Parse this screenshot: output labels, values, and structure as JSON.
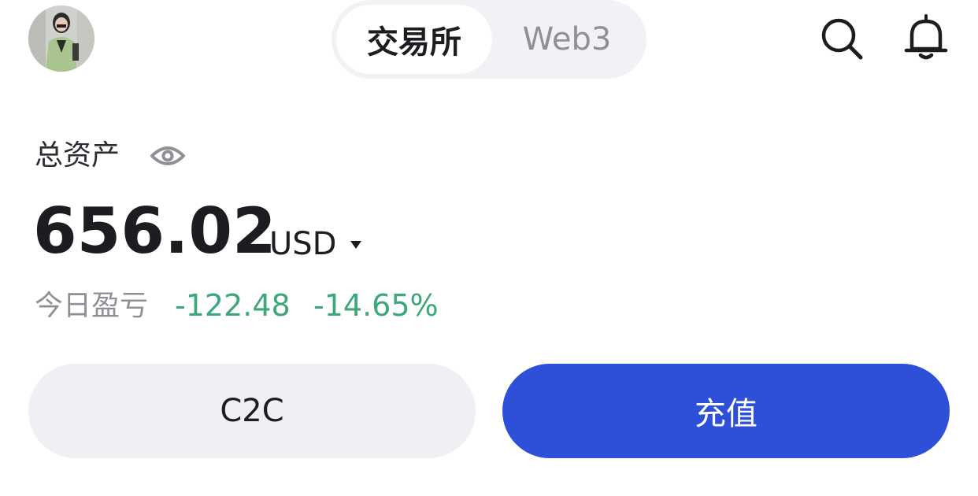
{
  "header": {
    "avatar_icon": "user-avatar-photo",
    "tabs": [
      {
        "label": "交易所",
        "active": true
      },
      {
        "label": "Web3",
        "active": false
      }
    ],
    "search_icon": "search-icon",
    "bell_icon": "bell-icon"
  },
  "assets": {
    "total_label": "总资产",
    "visibility_icon": "eye-icon",
    "balance": "656.02",
    "currency": "USD",
    "currency_icon": "caret-down-icon",
    "pnl_label": "今日盈亏",
    "pnl_value": "-122.48",
    "pnl_percent": "-14.65%"
  },
  "actions": {
    "c2c_label": "C2C",
    "deposit_label": "充值"
  },
  "colors": {
    "accent": "#2e50d8",
    "loss": "#3ea77a",
    "text_primary": "#1b1d21",
    "text_muted": "#8e9096"
  }
}
